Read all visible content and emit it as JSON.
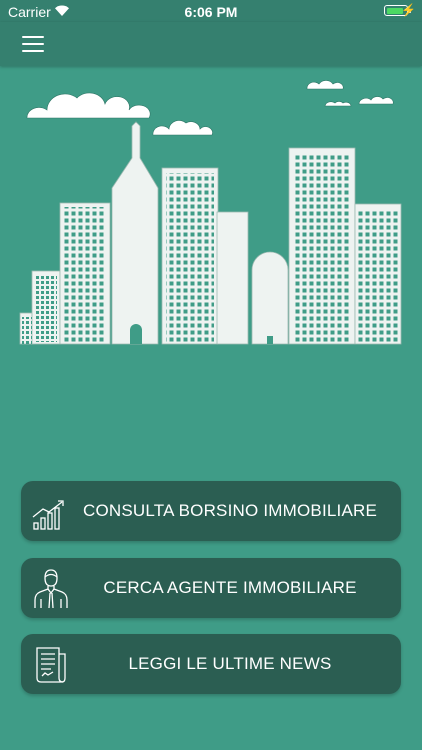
{
  "status_bar": {
    "carrier": "Carrier",
    "time": "6:06 PM",
    "battery_level": 0.92
  },
  "nav": {
    "menu_icon": "hamburger-menu-icon"
  },
  "actions": [
    {
      "icon": "bar-chart-growth-icon",
      "label": "CONSULTA BORSINO IMMOBILIARE"
    },
    {
      "icon": "agent-person-icon",
      "label": "CERCA AGENTE IMMOBILIARE"
    },
    {
      "icon": "news-document-icon",
      "label": "LEGGI LE ULTIME NEWS"
    }
  ],
  "colors": {
    "background": "#3f9c87",
    "bar": "#35806f",
    "button": "#2b5e52",
    "text": "#ffffff"
  }
}
